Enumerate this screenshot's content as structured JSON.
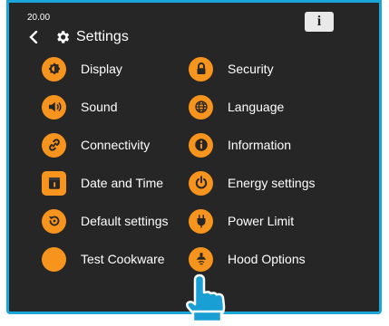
{
  "status": {
    "time": "20.00"
  },
  "header": {
    "title": "Settings",
    "back_icon": "chevron-left-icon",
    "title_icon": "gear-icon"
  },
  "info_button": {
    "label": "i"
  },
  "colors": {
    "accent": "#f7941d",
    "background": "#262626",
    "frame": "#1aa6d8",
    "text": "#ffffff"
  },
  "menu": {
    "left": [
      {
        "label": "Display",
        "icon": "display-icon"
      },
      {
        "label": "Sound",
        "icon": "speaker-icon"
      },
      {
        "label": "Connectivity",
        "icon": "link-icon"
      },
      {
        "label": "Date and Time",
        "icon": "calendar-icon"
      },
      {
        "label": "Default settings",
        "icon": "reset-icon"
      },
      {
        "label": "Test Cookware",
        "icon": "cookware-icon"
      }
    ],
    "right": [
      {
        "label": "Security",
        "icon": "lock-icon"
      },
      {
        "label": "Language",
        "icon": "globe-icon"
      },
      {
        "label": "Information",
        "icon": "info-icon"
      },
      {
        "label": "Energy settings",
        "icon": "power-icon"
      },
      {
        "label": "Power Limit",
        "icon": "plug-icon"
      },
      {
        "label": "Hood Options",
        "icon": "hood-icon"
      }
    ]
  },
  "pointer": {
    "icon": "hand-pointer-icon"
  }
}
